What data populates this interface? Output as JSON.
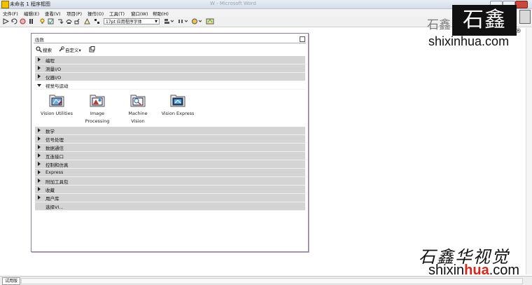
{
  "window": {
    "title": "未命名 1 程序框图",
    "background_app_title": "W - Microsoft Word"
  },
  "menu": [
    "文件(F)",
    "编辑(E)",
    "查看(V)",
    "项目(P)",
    "操作(O)",
    "工具(T)",
    "窗口(W)",
    "帮助(H)"
  ],
  "toolbar": {
    "font_selector": "17pt 应用程序字体"
  },
  "palette": {
    "title": "函数",
    "search_label": "搜索",
    "customize_label": "自定义▾",
    "categories_top": [
      "编程",
      "测量I/O",
      "仪器I/O"
    ],
    "open_category": "视觉与运动",
    "subpalettes": [
      {
        "label_line1": "Vision Utilities",
        "label_line2": ""
      },
      {
        "label_line1": "Image",
        "label_line2": "Processing"
      },
      {
        "label_line1": "Machine",
        "label_line2": "Vision"
      },
      {
        "label_line1": "Vision Express",
        "label_line2": ""
      }
    ],
    "categories_bottom": [
      "数学",
      "信号处理",
      "数据通信",
      "互连接口",
      "控制和仿真",
      "Express",
      "附加工具包",
      "收藏",
      "用户库",
      "选择VI..."
    ]
  },
  "status": {
    "tag": "试用版"
  },
  "watermark": {
    "top_text": "石鑫",
    "box_text": "石鑫华",
    "reg_mark": "®",
    "top_url": "shixinhua.com",
    "bottom_calligraphy": "石鑫华视觉",
    "bottom_url_pre": "shixin",
    "bottom_url_bold": "hua",
    "bottom_url_post": ".com"
  },
  "colors": {
    "category_bg": "#d4d4d4",
    "palette_border": "#8c7a9a",
    "accent_red": "#d8261c"
  }
}
